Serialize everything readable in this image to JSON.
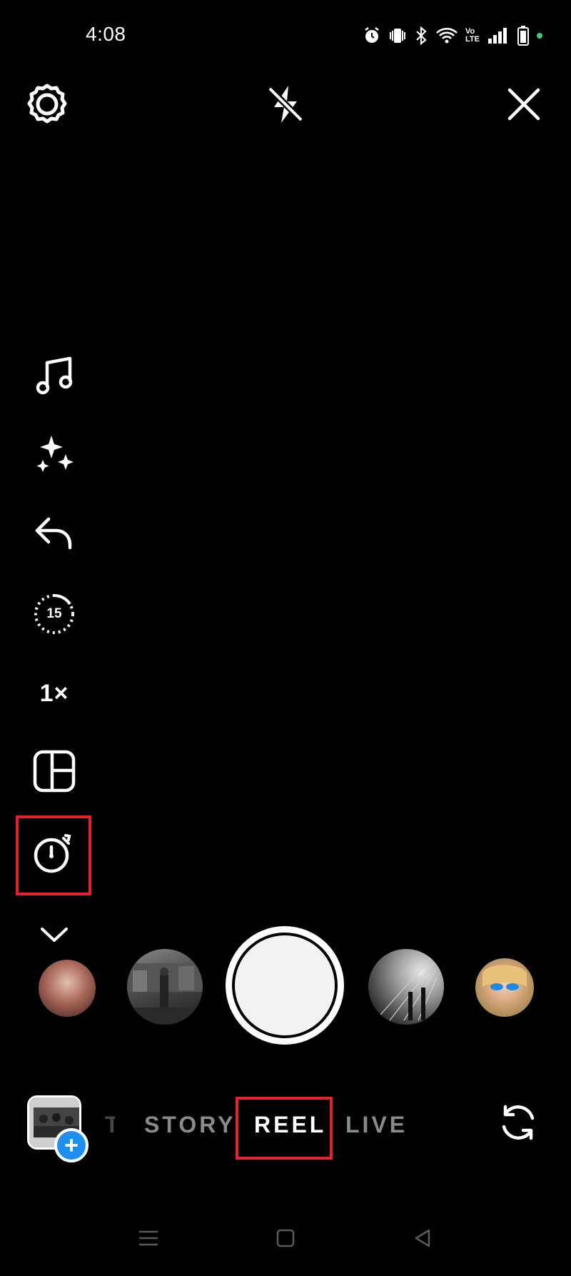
{
  "status_bar": {
    "time": "4:08",
    "icons": [
      "alarm-icon",
      "vibrate-icon",
      "bluetooth-icon",
      "wifi-icon",
      "volte-icon",
      "signal-icon",
      "battery-icon"
    ],
    "volte_line1": "Vo",
    "volte_line2": "LTE"
  },
  "top_bar": {
    "settings_icon": "gear-icon",
    "flash_icon": "flash-off-icon",
    "close_icon": "close-icon"
  },
  "tools": [
    {
      "name": "music-icon"
    },
    {
      "name": "effects-sparkles-icon"
    },
    {
      "name": "undo-icon"
    },
    {
      "name": "length-timer-icon",
      "label": "15"
    },
    {
      "name": "speed",
      "label": "1×"
    },
    {
      "name": "layout-icon"
    },
    {
      "name": "countdown-timer-icon",
      "highlighted": true
    },
    {
      "name": "more-chevron-icon"
    }
  ],
  "modes": {
    "left_partial": "T",
    "story": "STORY",
    "reel": "REEL",
    "live": "LIVE"
  },
  "colors": {
    "highlight": "#e8202a",
    "accent_blue": "#1f8ef1",
    "inactive_mode": "#8a8a8a"
  },
  "nav_bar": {
    "items": [
      "menu-icon",
      "home-square-icon",
      "back-triangle-icon"
    ]
  }
}
